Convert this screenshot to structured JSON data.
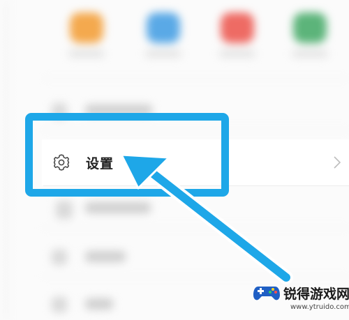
{
  "settings_item": {
    "label": "设置",
    "icon": "gear-icon",
    "trailing_icon": "chevron-right-icon"
  },
  "annotation": {
    "highlight_color": "#1ea7e8",
    "pointer": "arrow-icon"
  },
  "watermark": {
    "title": "锐得游戏网",
    "url": "www.ytruido.com"
  },
  "colors": {
    "app_icons": [
      "#f4a94e",
      "#5aa9e6",
      "#ee6b64",
      "#5cb47a"
    ]
  }
}
